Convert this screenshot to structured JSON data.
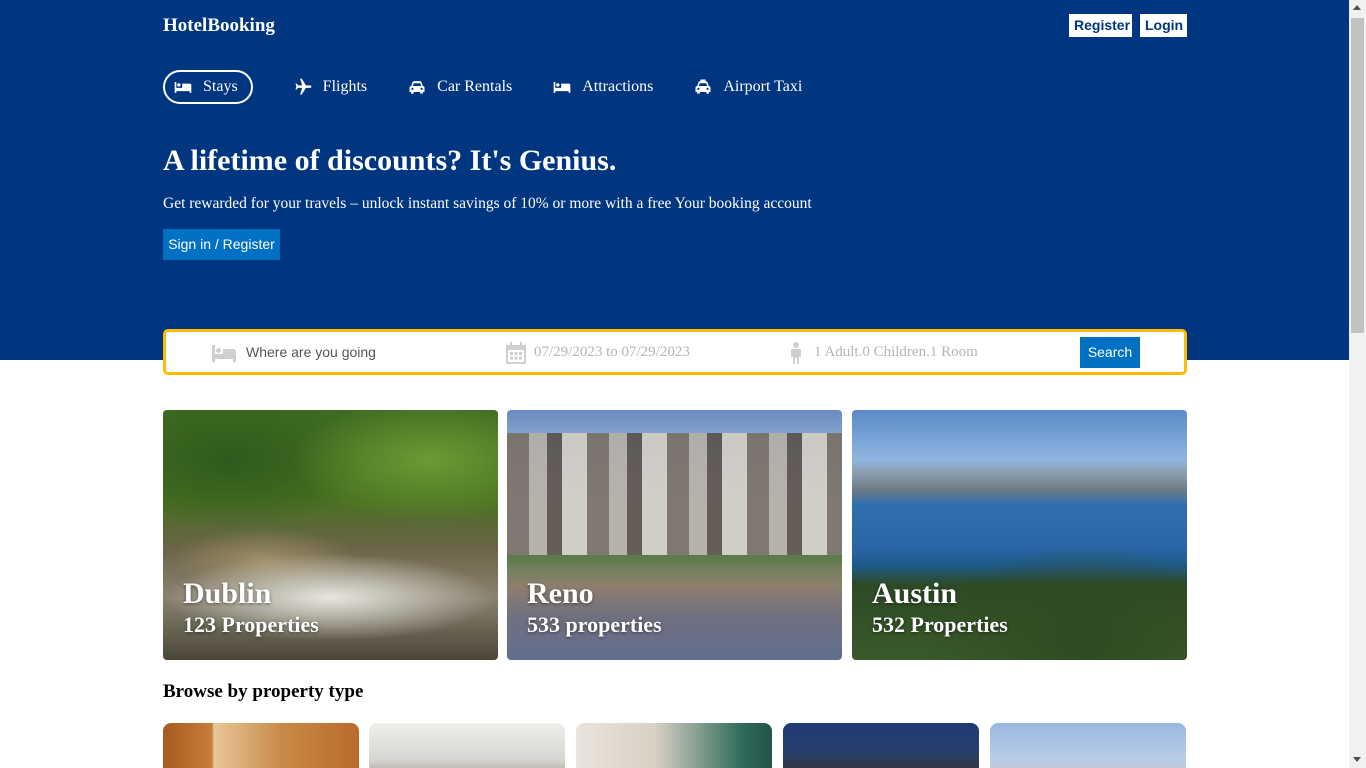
{
  "header": {
    "logo": "HotelBooking",
    "register_label": "Register",
    "login_label": "Login",
    "bg_color": "#003580"
  },
  "nav": {
    "items": [
      {
        "label": "Stays",
        "icon": "bed-icon",
        "active": true
      },
      {
        "label": "Flights",
        "icon": "plane-icon"
      },
      {
        "label": "Car Rentals",
        "icon": "car-icon"
      },
      {
        "label": "Attractions",
        "icon": "bed-icon"
      },
      {
        "label": "Airport Taxi",
        "icon": "taxi-icon"
      }
    ]
  },
  "hero": {
    "title": "A lifetime of discounts? It's Genius.",
    "subtitle": "Get rewarded for your travels – unlock instant savings of 10% or more with a free Your booking account",
    "button_label": "Sign in / Register"
  },
  "search": {
    "destination_placeholder": "Where are you going",
    "dates": "07/29/2023 to 07/29/2023",
    "guests": "1 Adult.0 Children.1 Room",
    "button_label": "Search",
    "border_color": "#febb02"
  },
  "featured": [
    {
      "city": "Dublin",
      "properties": "123 Properties"
    },
    {
      "city": "Reno",
      "properties": "533 properties"
    },
    {
      "city": "Austin",
      "properties": "532 Properties"
    }
  ],
  "property_types": {
    "title": "Browse by property type"
  },
  "colors": {
    "primary_button": "#0071c2"
  }
}
